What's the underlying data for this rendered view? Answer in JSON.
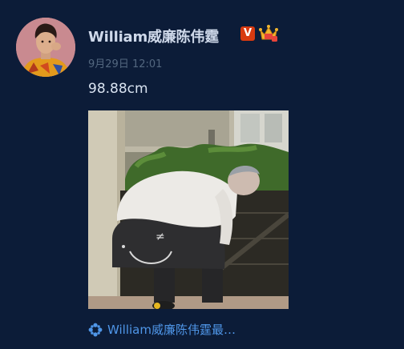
{
  "post": {
    "username": "William威廉陈伟霆",
    "timestamp": "9月29日 12:01",
    "text": "98.88cm",
    "verified_badge": "V",
    "link_text": "William威廉陈伟霆最…"
  },
  "icons": {
    "verified": "verified-v-badge-icon",
    "member": "crown-member-icon",
    "link": "flower-link-icon"
  },
  "colors": {
    "background": "#0c1c38",
    "username": "#cfd9ea",
    "timestamp": "#53677f",
    "text": "#d9e3f1",
    "link": "#4f96e8",
    "verified": "#d83a10"
  }
}
